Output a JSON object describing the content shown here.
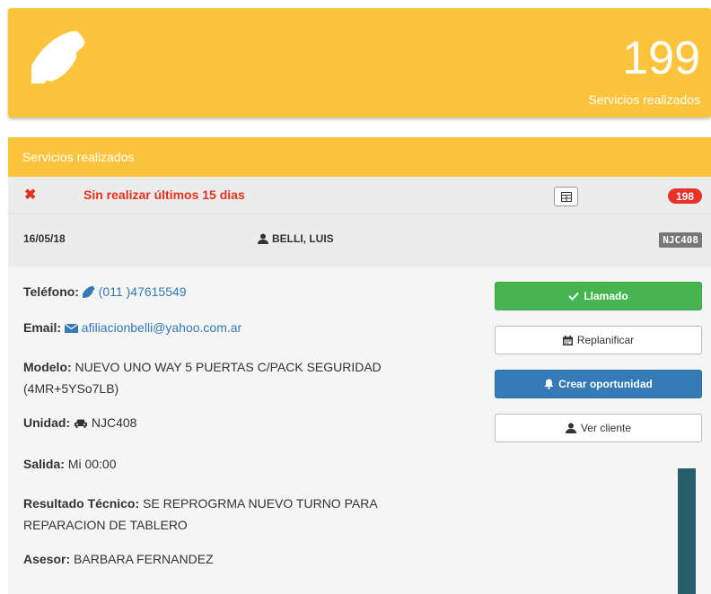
{
  "stat": {
    "count": "199",
    "label": "Servicios realizados",
    "icon": "phone-icon"
  },
  "panel": {
    "heading": "Servicios realizados",
    "filter": {
      "title": "Sin realizar últimos 15 dias",
      "badge": "198",
      "close_icon": "times-icon",
      "grid_icon": "table-icon"
    },
    "record": {
      "date": "16/05/18",
      "client": "BELLI, LUIS",
      "plate": "NJC408"
    }
  },
  "details": {
    "telefono_label": "Teléfono:",
    "telefono_value": "(011 )47615549",
    "email_label": "Email:",
    "email_value": "afiliacionbelli@yahoo.com.ar",
    "modelo_label": "Modelo:",
    "modelo_value": "NUEVO UNO WAY 5 PUERTAS C/PACK SEGURIDAD",
    "modelo_value_2": "(4MR+5YSo7LB)",
    "unidad_label": "Unidad:",
    "unidad_value": "NJC408",
    "salida_label": "Salida:",
    "salida_value": "Mi 00:00",
    "resultado_label": "Resultado Técnico:",
    "resultado_value": "SE REPROGRMA NUEVO TURNO PARA",
    "resultado_value_2": "REPARACION DE TABLERO",
    "asesor_label": "Asesor:",
    "asesor_value": "BARBARA FERNANDEZ"
  },
  "actions": {
    "llamado": "Llamado",
    "replanificar": "Replanificar",
    "crear_oportunidad": "Crear oportunidad",
    "ver_cliente": "Ver cliente"
  },
  "colors": {
    "accent": "#fcc43c",
    "danger": "#e0321f",
    "success": "#46b550",
    "primary": "#337ab7"
  }
}
